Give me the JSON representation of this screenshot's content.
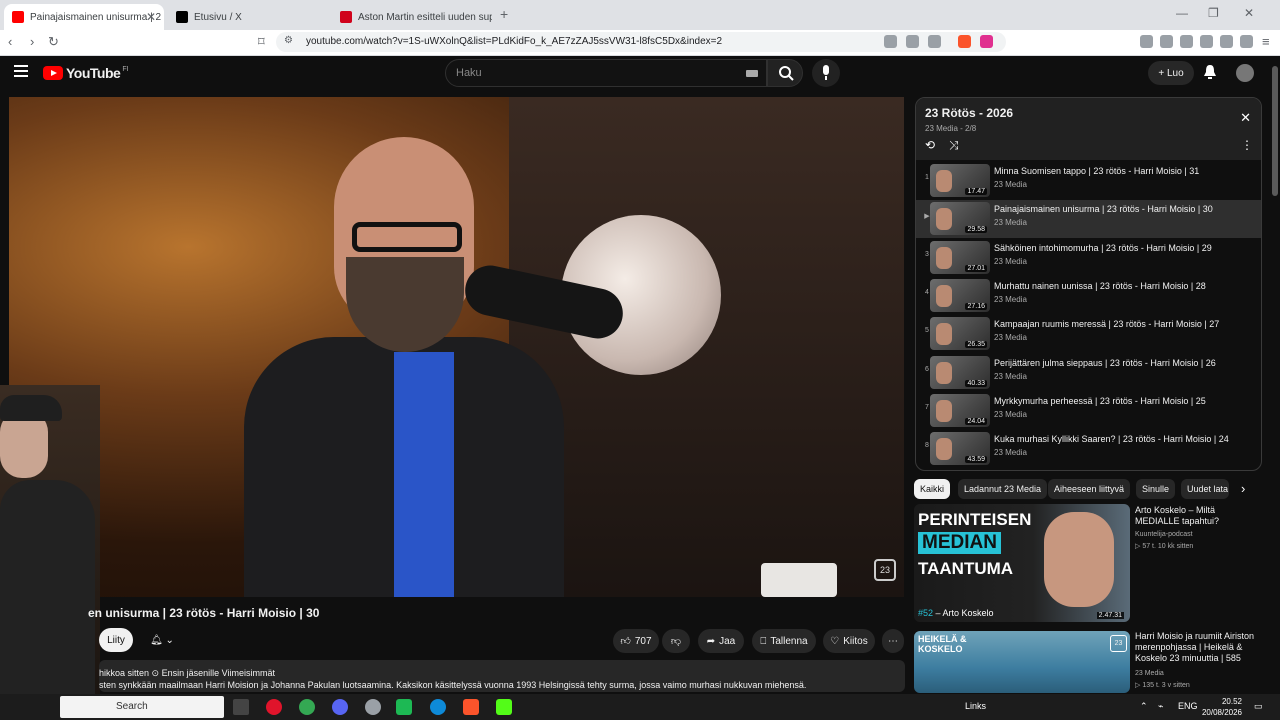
{
  "browser": {
    "tabs": [
      {
        "label": "Painajaismainen unisurma | 2",
        "active": true,
        "favicon_color": "#ff0000"
      },
      {
        "label": "Etusivu / X",
        "active": false,
        "favicon_color": "#000000"
      },
      {
        "label": "Aston Martin esitteli uuden superaut",
        "active": false,
        "favicon_color": "#d0021b"
      }
    ],
    "url": "youtube.com/watch?v=1S-uWXolnQ&list=PLdKidFo_k_AE7zZAJ5ssVW31-l8fsC5Dx&index=2"
  },
  "youtube": {
    "logo_text": "YouTube",
    "logo_country": "FI",
    "search_placeholder": "Haku",
    "create_label": "Luo"
  },
  "video": {
    "title_visible": "en unisurma | 23 rötös - Harri Moisio | 30",
    "join_label": "Liity",
    "likes": "707",
    "share_label": "Jaa",
    "save_label": "Tallenna",
    "thanks_label": "Kiitos",
    "overlay_logo": "23",
    "desc_line1": "hikkoa sitten  ⊙ Ensin jäsenille  Viimeisimmät",
    "desc_line2": "sten synkkään maailmaan Harri Moision ja Johanna Pakulan luotsaamina. Kaksikon käsittelyssä vuonna 1993 Helsingissä tehty surma, jossa vaimo murhasi nukkuvan miehensä."
  },
  "playlist": {
    "title": "23 Rötös - 2026",
    "subtitle": "23 Media - 2/8",
    "items": [
      {
        "num": "1",
        "title": "Minna Suomisen tappo | 23 rötös - Harri Moisio | 31",
        "channel": "23 Media",
        "duration": "17.47",
        "current": false
      },
      {
        "num": "▶",
        "title": "Painajaismainen unisurma | 23 rötös - Harri Moisio | 30",
        "channel": "23 Media",
        "duration": "29.58",
        "current": true
      },
      {
        "num": "3",
        "title": "Sähköinen intohimomurha | 23 rötös - Harri Moisio | 29",
        "channel": "23 Media",
        "duration": "27.01",
        "current": false
      },
      {
        "num": "4",
        "title": "Murhattu nainen uunissa | 23 rötös - Harri Moisio | 28",
        "channel": "23 Media",
        "duration": "27.16",
        "current": false
      },
      {
        "num": "5",
        "title": "Kampaajan ruumis meressä | 23 rötös - Harri Moisio | 27",
        "channel": "23 Media",
        "duration": "26.35",
        "current": false
      },
      {
        "num": "6",
        "title": "Perijättären julma sieppaus | 23 rötös - Harri Moisio | 26",
        "channel": "23 Media",
        "duration": "40.33",
        "current": false
      },
      {
        "num": "7",
        "title": "Myrkkymurha perheessä | 23 rötös - Harri Moisio | 25",
        "channel": "23 Media",
        "duration": "24.04",
        "current": false
      },
      {
        "num": "8",
        "title": "Kuka murhasi Kyllikki Saaren? | 23 rötös - Harri Moisio | 24",
        "channel": "23 Media",
        "duration": "43.59",
        "current": false
      }
    ]
  },
  "chips": [
    "Kaikki",
    "Ladannut 23 Media",
    "Aiheeseen liittyvä",
    "Sinulle",
    "Uudet lata"
  ],
  "recommendations": [
    {
      "thumb_lines": [
        "PERINTEISEN",
        "MEDIAN",
        "TAANTUMA"
      ],
      "thumb_hash": "#52",
      "thumb_name": " – Arto Koskelo",
      "duration": "2.47.31",
      "title": "Arto Koskelo – Miltä MEDIALLE tapahtui?",
      "channel": "Kuuntelija-podcast",
      "meta": "▷ 57 t.  10 kk sitten"
    },
    {
      "thumb_lines": [
        "HEIKELÄ &",
        "KOSKELO"
      ],
      "logo": "23",
      "title": "Harri Moisio ja ruumiit Airiston merenpohjassa | Heikelä & Koskelo 23 minuuttia | 585",
      "channel": "23 Media",
      "meta": "▷ 135 t.  3 v sitten"
    }
  ],
  "taskbar": {
    "search_text": "Search",
    "links_label": "Links",
    "lang": "ENG",
    "time": "20.52",
    "date": "20/08/2026"
  }
}
